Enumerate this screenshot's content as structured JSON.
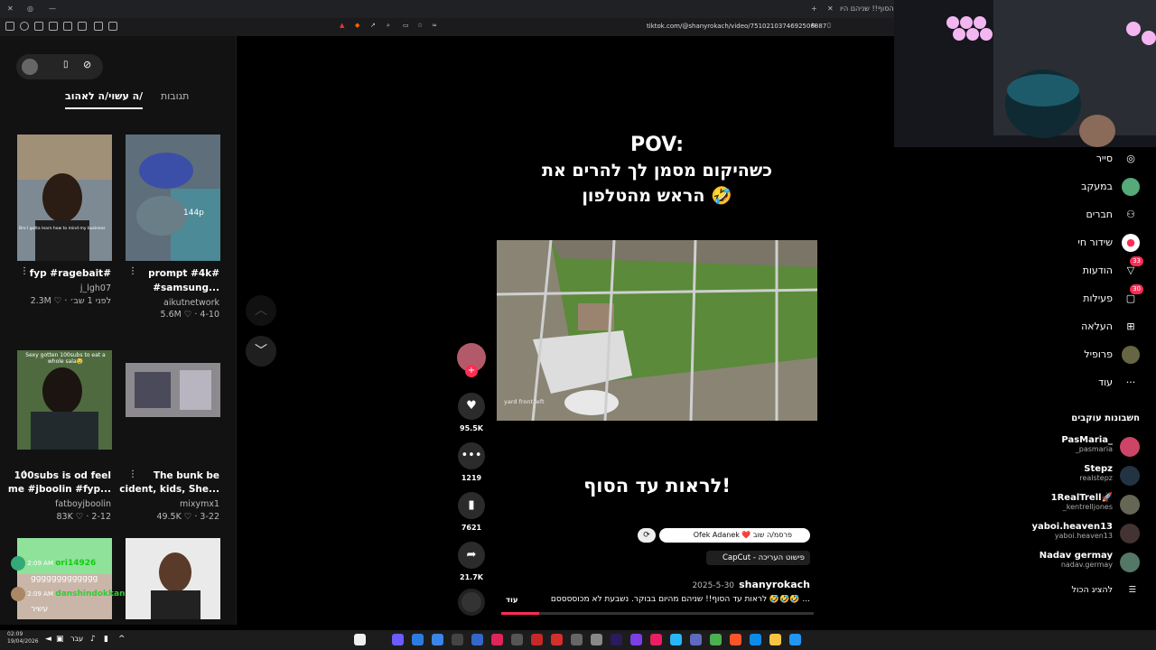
{
  "browser": {
    "tab_title": "עד הסוף!! שניהם היו...",
    "url": "tiktok.com/@shanyrokach/video/7510210374692506887"
  },
  "left": {
    "tabs": [
      "את/ה עשוי/ה לאהוב",
      "תגובות"
    ],
    "tiles": [
      {
        "caption": "fyp #ragebait#",
        "user": "j_lgh07",
        "stats": "2.3M ♡ · לפני 1 שב׳",
        "overlay": "Bro I gotta learn how to mind my business"
      },
      {
        "caption": "prompt #4k#",
        "caption2": "#samsung...",
        "user": "aikutnetwork",
        "stats": "5.6M ♡ · 4-10",
        "overlay": "144p"
      },
      {
        "caption": "100subs is od feel",
        "caption2": "me #jboolin #fyp...",
        "user": "fatboyjboolin",
        "stats": "83K ♡ · 2-12",
        "overlay": "Sexy gotten 100subs to eat a whole sala🤤"
      },
      {
        "caption": "The bunk be",
        "caption2": "cident, kids, She...",
        "user": "mixymx1",
        "stats": "49.5K ♡ · 3-22",
        "overlay": ""
      },
      {
        "caption": "",
        "user": "",
        "stats": "",
        "overlay": "ori14926"
      },
      {
        "caption": "",
        "user": "",
        "stats": "",
        "overlay": ""
      }
    ],
    "chat": [
      {
        "time": "2:09 AM",
        "name": "ori14926",
        "msg": "ggggggggggggg"
      },
      {
        "time": "2:09 AM",
        "name": "danshindokkan",
        "msg": "עשיר"
      }
    ]
  },
  "video": {
    "pov": "POV:",
    "line1": "כשהיקום מסמן לך להרים את",
    "line2": "הראש מהטלפון 🤣",
    "bottom_text": "לראות עד הסוף!",
    "cam_label": "yard front left",
    "likes": "95.5K",
    "comments": "1219",
    "saves": "7621",
    "shares": "21.7K",
    "collab": "Ofek Adanek ❤️ פרסמ/ה שוב",
    "capcut": "CapCut - פישוט העריכה",
    "author": "shanyrokach",
    "date": "2025-5-30",
    "desc": "לראות עד הסוף!! שניהם מהיום בבוקר. נשבעת לא מכוססססם 🤣🤣🤣 ...",
    "more": "עוד"
  },
  "nav": {
    "items": [
      {
        "label": "סייר",
        "icon": "compass-icon"
      },
      {
        "label": "במעקב",
        "icon": "following-icon"
      },
      {
        "label": "חברים",
        "icon": "friends-icon"
      },
      {
        "label": "שידור חי",
        "icon": "live-icon"
      },
      {
        "label": "הודעות",
        "icon": "inbox-icon",
        "badge": "33"
      },
      {
        "label": "פעילות",
        "icon": "activity-icon",
        "badge": "30"
      },
      {
        "label": "העלאה",
        "icon": "upload-icon"
      },
      {
        "label": "פרופיל",
        "icon": "profile-icon"
      },
      {
        "label": "עוד",
        "icon": "more-icon"
      }
    ],
    "following_title": "חשבונות עוקבים",
    "accounts": [
      {
        "name": "PasMaria_",
        "user": "_pasmaria"
      },
      {
        "name": "Stepz",
        "user": "realstepz"
      },
      {
        "name": "1RealTrell🚀",
        "user": "_kentrelljones"
      },
      {
        "name": "yaboi.heaven13",
        "user": "yaboi.heaven13"
      },
      {
        "name": "Nadav germay",
        "user": "nadav.germay"
      }
    ],
    "see_all": "להציג הכול"
  },
  "taskbar": {
    "time": "02:09",
    "date": "19/04/2026",
    "lang": "עבר"
  },
  "colors": {
    "accent": "#fe2c55",
    "bg": "#000000"
  }
}
